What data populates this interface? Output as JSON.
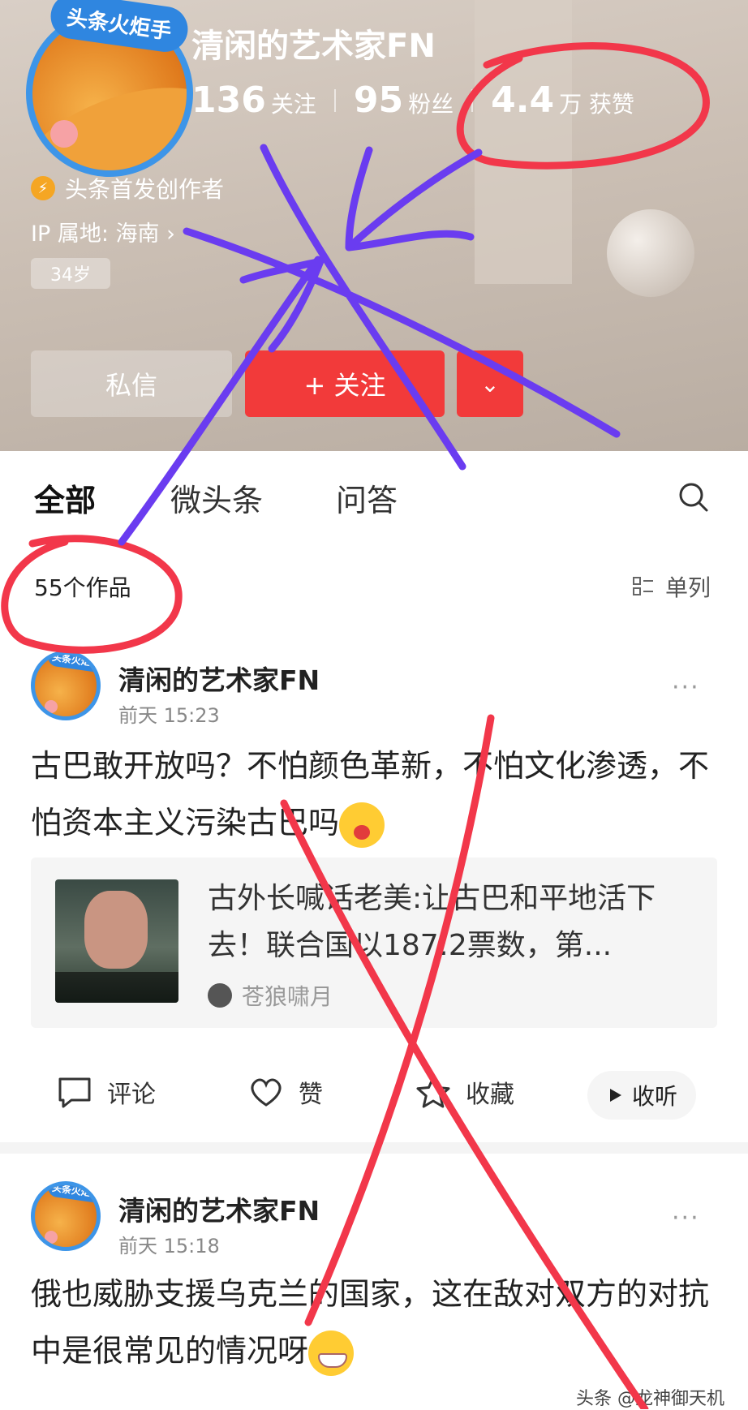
{
  "profile": {
    "badge": "头条火炬手",
    "name": "清闲的艺术家FN",
    "stats": [
      {
        "num": "136",
        "label": "关注"
      },
      {
        "num": "95",
        "label": "粉丝"
      },
      {
        "num": "4.4",
        "label": "万 获赞"
      }
    ],
    "creator": "头条首发创作者",
    "ip": "IP 属地: 海南 ›",
    "age": "34岁",
    "message_label": "私信",
    "follow_label": "+ 关注",
    "more_label": "⌄"
  },
  "tabs": [
    "全部",
    "微头条",
    "问答"
  ],
  "works_count": "55个作品",
  "layout_label": "单列",
  "posts": [
    {
      "author": "清闲的艺术家FN",
      "time": "前天  15:23",
      "dots": "···",
      "text": "古巴敢开放吗？不怕颜色革新，不怕文化渗透，不怕资本主义污染古巴吗",
      "link": {
        "title": "古外长喊话老美:让古巴和平地活下去！联合国以187:2票数，第...",
        "author": "苍狼啸月"
      },
      "actions": {
        "comment": "评论",
        "like": "赞",
        "collect": "收藏",
        "listen": "收听"
      }
    },
    {
      "author": "清闲的艺术家FN",
      "time": "前天  15:18",
      "dots": "···",
      "text": "俄也威胁支援乌克兰的国家，这在敌对双方的对抗中是很常见的情况呀"
    }
  ],
  "watermark": "头条 @龙神御天机",
  "colors": {
    "brand_red": "#f23a3a",
    "avatar_ring": "#3d95e8",
    "scribble_red": "#f2374a",
    "scribble_purple": "#6a3cf0"
  }
}
